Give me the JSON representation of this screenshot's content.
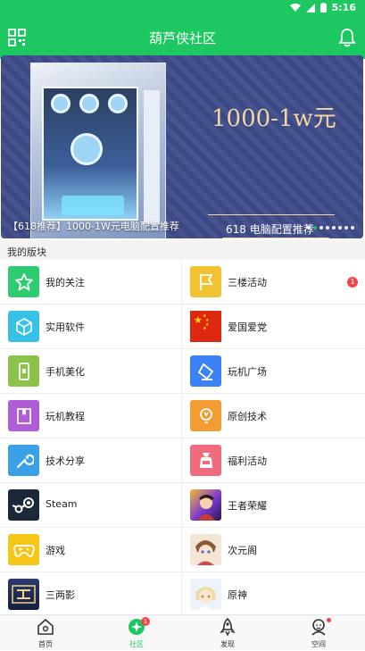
{
  "status_bar": {
    "time": "5:16"
  },
  "app_bar": {
    "title": "葫芦侠社区"
  },
  "banner": {
    "headline": "1000-1w元",
    "subheadline": "618 电脑配置推荐",
    "caption": "【618推荐】1000-1W元电脑配置推荐",
    "slide_count": 8,
    "active_slide": 2
  },
  "section": {
    "title": "我的版块"
  },
  "boards": [
    {
      "label": "我的关注",
      "icon": "star-icon",
      "color": "#2ecc71"
    },
    {
      "label": "三楼活动",
      "icon": "flag-icon",
      "color": "#f1c232",
      "badge": "1"
    },
    {
      "label": "实用软件",
      "icon": "cube-icon",
      "color": "#38c1e6"
    },
    {
      "label": "爱国爱党",
      "icon": "china-flag-icon",
      "color": "#de2910"
    },
    {
      "label": "手机美化",
      "icon": "phone-icon",
      "color": "#8bc34a"
    },
    {
      "label": "玩机广场",
      "icon": "eraser-icon",
      "color": "#3b82f6"
    },
    {
      "label": "玩机教程",
      "icon": "book-icon",
      "color": "#b05bd8"
    },
    {
      "label": "原创技术",
      "icon": "bulb-icon",
      "color": "#f39c34"
    },
    {
      "label": "技术分享",
      "icon": "wrench-icon",
      "color": "#3aa0e8"
    },
    {
      "label": "福利活动",
      "icon": "gift-bag-icon",
      "color": "#f06b7e"
    },
    {
      "label": "Steam",
      "icon": "steam-icon",
      "color": "#1b2838"
    },
    {
      "label": "王者荣耀",
      "icon": "game-avatar-icon",
      "color": "#7b3ad1"
    },
    {
      "label": "游戏",
      "icon": "gamepad-icon",
      "color": "#f5c518"
    },
    {
      "label": "次元阁",
      "icon": "anime-avatar-icon",
      "color": "#d8b48a"
    },
    {
      "label": "三两影",
      "icon": "film-icon",
      "color": "#2a3b6e"
    },
    {
      "label": "原神",
      "icon": "genshin-avatar-icon",
      "color": "#e9d7b8"
    }
  ],
  "tabs": [
    {
      "label": "首页",
      "icon": "home-icon"
    },
    {
      "label": "社区",
      "icon": "community-icon",
      "badge": "1",
      "active": true
    },
    {
      "label": "发现",
      "icon": "rocket-icon"
    },
    {
      "label": "空间",
      "icon": "profile-icon",
      "dot": true
    }
  ],
  "colors": {
    "accent": "#1dc860",
    "badge": "#f04848",
    "banner_bg": "#3e4c8a",
    "banner_text": "#f3d7a1"
  }
}
